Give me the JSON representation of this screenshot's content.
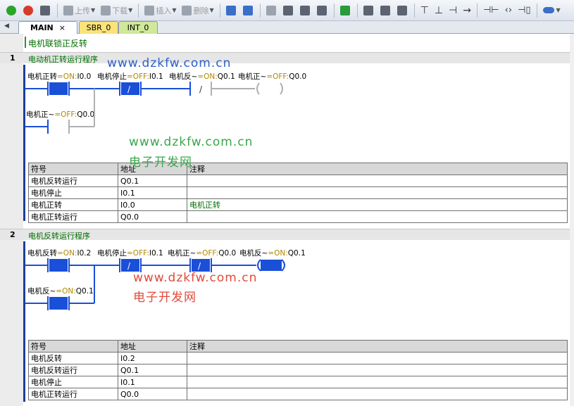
{
  "toolbar": {
    "upload_label": "上传",
    "download_label": "下载",
    "insert_label": "插入",
    "delete_label": "删除"
  },
  "tabs": [
    {
      "label": "MAIN",
      "close": "×"
    },
    {
      "label": "SBR_0"
    },
    {
      "label": "INT_0"
    }
  ],
  "program_title": "电机联锁正反转",
  "networks": [
    {
      "number": "1",
      "title": "电动机正转运行程序",
      "contacts": [
        {
          "name": "电机正转",
          "state": "=ON:",
          "addr": "I0.0"
        },
        {
          "name": "电机停止",
          "state": "=OFF:",
          "addr": "I0.1"
        },
        {
          "name": "电机反~",
          "state": "=ON:",
          "addr": "Q0.1"
        },
        {
          "name": "电机正~",
          "state": "=OFF:",
          "addr": "Q0.0"
        }
      ],
      "branch": {
        "name": "电机正~",
        "state": "=OFF:",
        "addr": "Q0.0"
      },
      "nc_symbol": "/",
      "table": {
        "headers": [
          "符号",
          "地址",
          "注释"
        ],
        "rows": [
          [
            "电机反转运行",
            "Q0.1",
            ""
          ],
          [
            "电机停止",
            "I0.1",
            ""
          ],
          [
            "电机正转",
            "I0.0",
            "电机正转"
          ],
          [
            "电机正转运行",
            "Q0.0",
            ""
          ]
        ]
      }
    },
    {
      "number": "2",
      "title": "电机反转运行程序",
      "contacts": [
        {
          "name": "电机反转",
          "state": "=ON:",
          "addr": "I0.2"
        },
        {
          "name": "电机停止",
          "state": "=OFF:",
          "addr": "I0.1"
        },
        {
          "name": "电机正~",
          "state": "=OFF:",
          "addr": "Q0.0"
        },
        {
          "name": "电机反~",
          "state": "=ON:",
          "addr": "Q0.1"
        }
      ],
      "branch": {
        "name": "电机反~",
        "state": "=ON:",
        "addr": "Q0.1"
      },
      "nc_symbol": "/",
      "table": {
        "headers": [
          "符号",
          "地址",
          "注释"
        ],
        "rows": [
          [
            "电机反转",
            "I0.2",
            ""
          ],
          [
            "电机反转运行",
            "Q0.1",
            ""
          ],
          [
            "电机停止",
            "I0.1",
            ""
          ],
          [
            "电机正转运行",
            "Q0.0",
            ""
          ]
        ]
      }
    }
  ],
  "watermarks": {
    "url": "www.dzkfw.com.cn",
    "name": "电子开发网"
  },
  "colors": {
    "rail": "#1b3f9a",
    "energized": "#1a4fd8",
    "wire_off": "#b0b0b0",
    "state_text": "#b08800",
    "comment_text": "#006f00"
  }
}
